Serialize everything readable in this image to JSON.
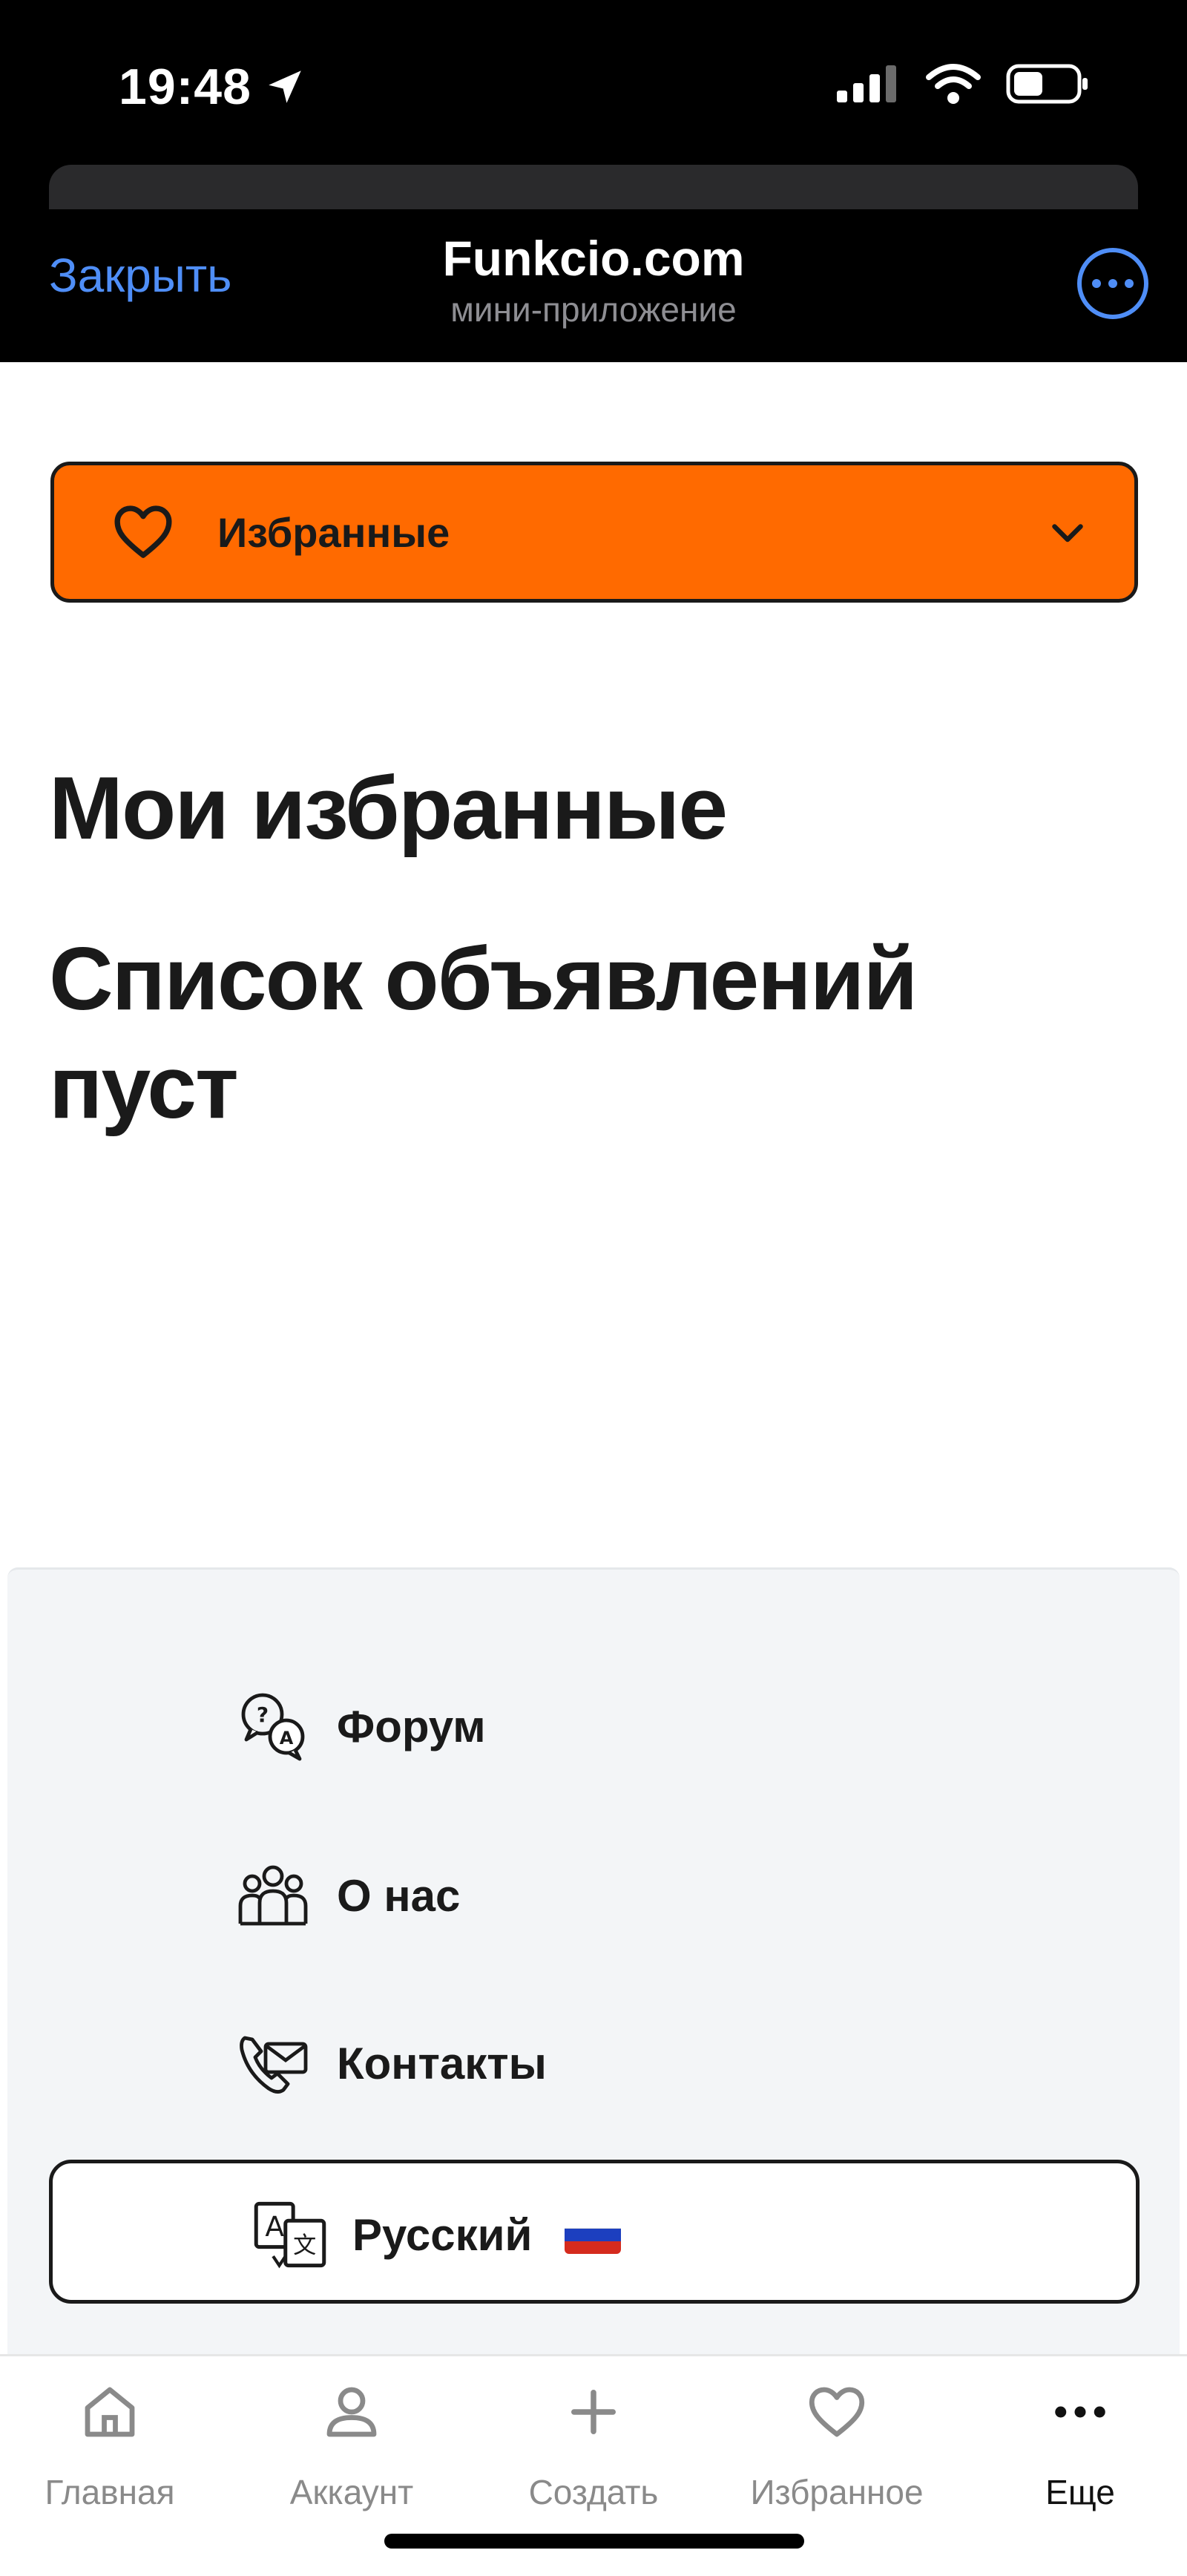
{
  "status_bar": {
    "time": "19:48"
  },
  "header": {
    "close_label": "Закрыть",
    "title": "Funkcio.com",
    "subtitle": "мини-приложение"
  },
  "dropdown": {
    "label": "Избранные",
    "color": "#ff6a00"
  },
  "main": {
    "title": "Мои избранные",
    "empty_message": "Список объявлений пуст"
  },
  "menu": {
    "items": [
      {
        "label": "Форум",
        "icon": "forum-icon"
      },
      {
        "label": "О нас",
        "icon": "team-icon"
      },
      {
        "label": "Контакты",
        "icon": "contact-icon"
      }
    ],
    "language": {
      "label": "Русский",
      "icon": "translate-icon",
      "flag": "russia-flag-icon"
    }
  },
  "tabs": [
    {
      "label": "Главная",
      "icon": "home-icon"
    },
    {
      "label": "Аккаунт",
      "icon": "user-icon"
    },
    {
      "label": "Создать",
      "icon": "plus-icon"
    },
    {
      "label": "Избранное",
      "icon": "heart-icon"
    },
    {
      "label": "Еще",
      "icon": "more-icon",
      "active": true
    }
  ],
  "colors": {
    "accent_blue": "#4f8ef7",
    "orange": "#ff6a00",
    "text": "#1a1a1a"
  }
}
